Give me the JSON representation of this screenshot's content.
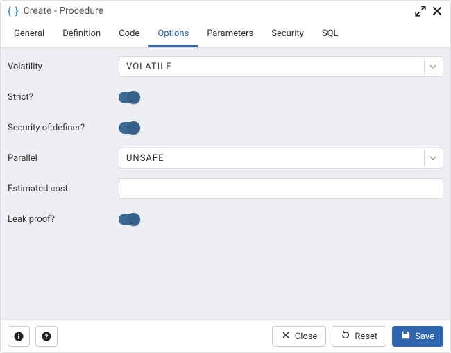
{
  "titlebar": {
    "brackets": "{ }",
    "title": "Create - Procedure"
  },
  "tabs": [
    {
      "label": "General",
      "active": false
    },
    {
      "label": "Definition",
      "active": false
    },
    {
      "label": "Code",
      "active": false
    },
    {
      "label": "Options",
      "active": true
    },
    {
      "label": "Parameters",
      "active": false
    },
    {
      "label": "Security",
      "active": false
    },
    {
      "label": "SQL",
      "active": false
    }
  ],
  "form": {
    "volatility_label": "Volatility",
    "volatility_value": "VOLATILE",
    "strict_label": "Strict?",
    "strict_value": true,
    "security_label": "Security of definer?",
    "security_value": true,
    "parallel_label": "Parallel",
    "parallel_value": "UNSAFE",
    "cost_label": "Estimated cost",
    "cost_value": "",
    "leakproof_label": "Leak proof?",
    "leakproof_value": true
  },
  "footer": {
    "close_label": "Close",
    "reset_label": "Reset",
    "save_label": "Save"
  }
}
